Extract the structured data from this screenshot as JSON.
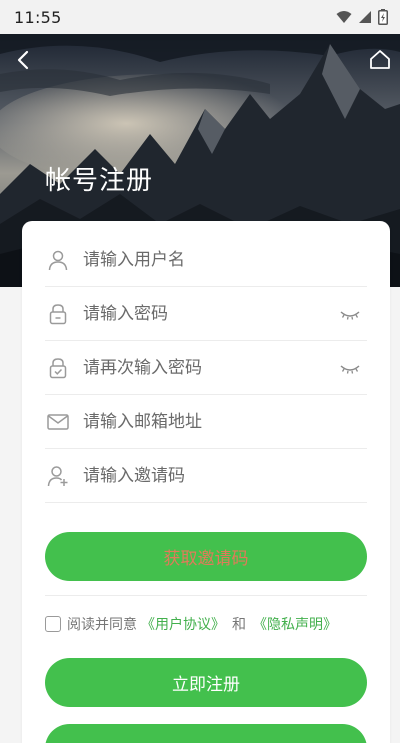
{
  "status": {
    "time": "11:55"
  },
  "header": {
    "title": "帐号注册"
  },
  "form": {
    "username_placeholder": "请输入用户名",
    "password_placeholder": "请输入密码",
    "password_confirm_placeholder": "请再次输入密码",
    "email_placeholder": "请输入邮箱地址",
    "invite_placeholder": "请输入邀请码"
  },
  "buttons": {
    "get_invite_code": "获取邀请码",
    "register": "立即注册",
    "third": ""
  },
  "agreement": {
    "prefix": "阅读并同意",
    "user_agreement": "《用户协议》",
    "and": "和",
    "privacy": "《隐私声明》"
  },
  "colors": {
    "accent_green": "#43c04d",
    "link_green": "#43b04d",
    "code_button_text": "#e07b5a"
  },
  "icons": [
    "back-icon",
    "home-icon",
    "wifi-icon",
    "signal-icon",
    "battery-icon",
    "user-icon",
    "lock-icon",
    "lock-check-icon",
    "mail-icon",
    "user-add-icon",
    "eye-closed-icon"
  ]
}
